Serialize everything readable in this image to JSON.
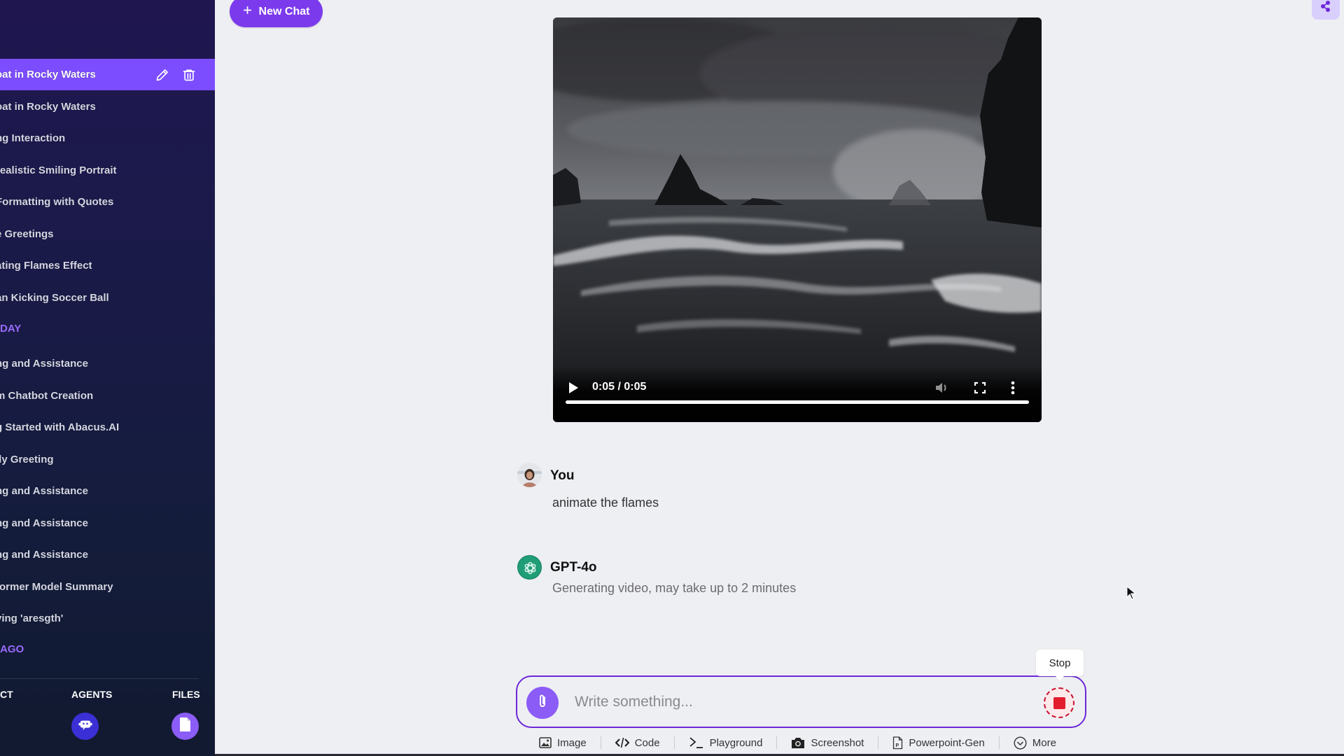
{
  "sidebar": {
    "active_item": {
      "label": "oat in Rocky Waters"
    },
    "items": [
      {
        "label": "oat in Rocky Waters"
      },
      {
        "label": "ng Interaction"
      },
      {
        "label": "realistic Smiling Portrait"
      },
      {
        "label": " Formatting with Quotes"
      },
      {
        "label": "e Greetings"
      },
      {
        "label": "ating Flames Effect"
      },
      {
        "label": "an Kicking Soccer Ball"
      }
    ],
    "section_yesterday": "DAY",
    "items_2": [
      {
        "label": "ng and Assistance"
      },
      {
        "label": "m Chatbot Creation"
      },
      {
        "label": "g Started with Abacus.AI"
      },
      {
        "label": "lly Greeting"
      },
      {
        "label": "ng and Assistance"
      },
      {
        "label": "ng and Assistance"
      },
      {
        "label": "ng and Assistance"
      },
      {
        "label": "former Model Summary"
      },
      {
        "label": "ying 'aresgth'"
      }
    ],
    "section_ago": "AGO",
    "bottom_tabs": [
      {
        "label": "CT",
        "icon": "project-icon"
      },
      {
        "label": "AGENTS",
        "icon": "robot-icon"
      },
      {
        "label": "FILES",
        "icon": "file-icon"
      }
    ]
  },
  "header": {
    "new_chat_label": "New Chat",
    "share_icon": "share-icon"
  },
  "video": {
    "time_display": "0:05 / 0:05",
    "progress_percent": 100
  },
  "messages": [
    {
      "author": "You",
      "text": "animate the flames",
      "avatar": "user-avatar"
    },
    {
      "author": "GPT-4o",
      "text": "Generating video, may take up to 2 minutes",
      "avatar": "gpt-avatar"
    }
  ],
  "composer": {
    "placeholder": "Write something...",
    "value": "",
    "stop_tooltip": "Stop"
  },
  "toolbar": {
    "tools": [
      {
        "label": "Image",
        "icon": "image-icon"
      },
      {
        "label": "Code",
        "icon": "code-icon"
      },
      {
        "label": "Playground",
        "icon": "terminal-icon"
      },
      {
        "label": "Screenshot",
        "icon": "camera-icon"
      },
      {
        "label": "Powerpoint-Gen",
        "icon": "powerpoint-icon"
      },
      {
        "label": "More",
        "icon": "chevron-down-circle-icon"
      }
    ]
  },
  "colors": {
    "accent": "#7c3aed",
    "sidebar_active": "#7c4dff",
    "section_heading": "#9a6bff",
    "stop_red": "#e11d2e",
    "gpt_green": "#1f9d77"
  }
}
